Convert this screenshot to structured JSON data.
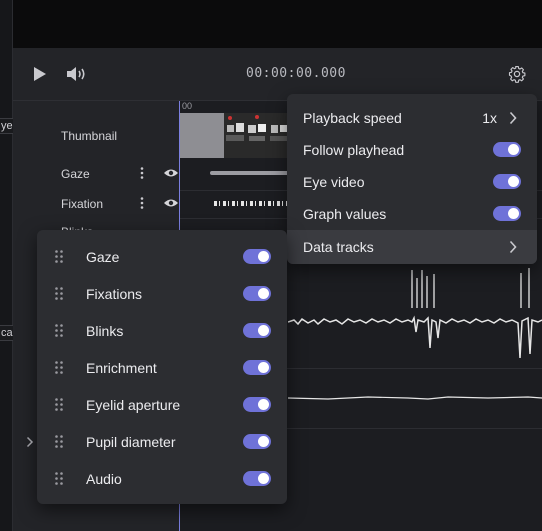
{
  "player": {
    "time": "00:00:00.000",
    "ruler_start": "00"
  },
  "edge_tags": [
    "ye",
    "ca"
  ],
  "track_labels": [
    "Thumbnail",
    "Gaze",
    "Fixation",
    "Blinks"
  ],
  "settings_menu": {
    "items": [
      {
        "label": "Playback speed",
        "value": "1x",
        "type": "submenu"
      },
      {
        "label": "Follow playhead",
        "type": "toggle",
        "on": true
      },
      {
        "label": "Eye video",
        "type": "toggle",
        "on": true
      },
      {
        "label": "Graph values",
        "type": "toggle",
        "on": true
      },
      {
        "label": "Data tracks",
        "type": "submenu"
      }
    ]
  },
  "data_tracks": [
    {
      "label": "Gaze",
      "on": true
    },
    {
      "label": "Fixations",
      "on": true
    },
    {
      "label": "Blinks",
      "on": true
    },
    {
      "label": "Enrichment",
      "on": true
    },
    {
      "label": "Eyelid aperture",
      "on": true
    },
    {
      "label": "Pupil diameter",
      "on": true
    },
    {
      "label": "Audio",
      "on": true
    }
  ],
  "colors": {
    "accent": "#6f72d8",
    "menu_bg": "#2c2d31",
    "app_bg": "#1f2024"
  },
  "icons": [
    "play-icon",
    "volume-icon",
    "gear-icon",
    "kebab-icon",
    "eye-icon",
    "chevron-right-icon",
    "drag-handle-icon"
  ]
}
